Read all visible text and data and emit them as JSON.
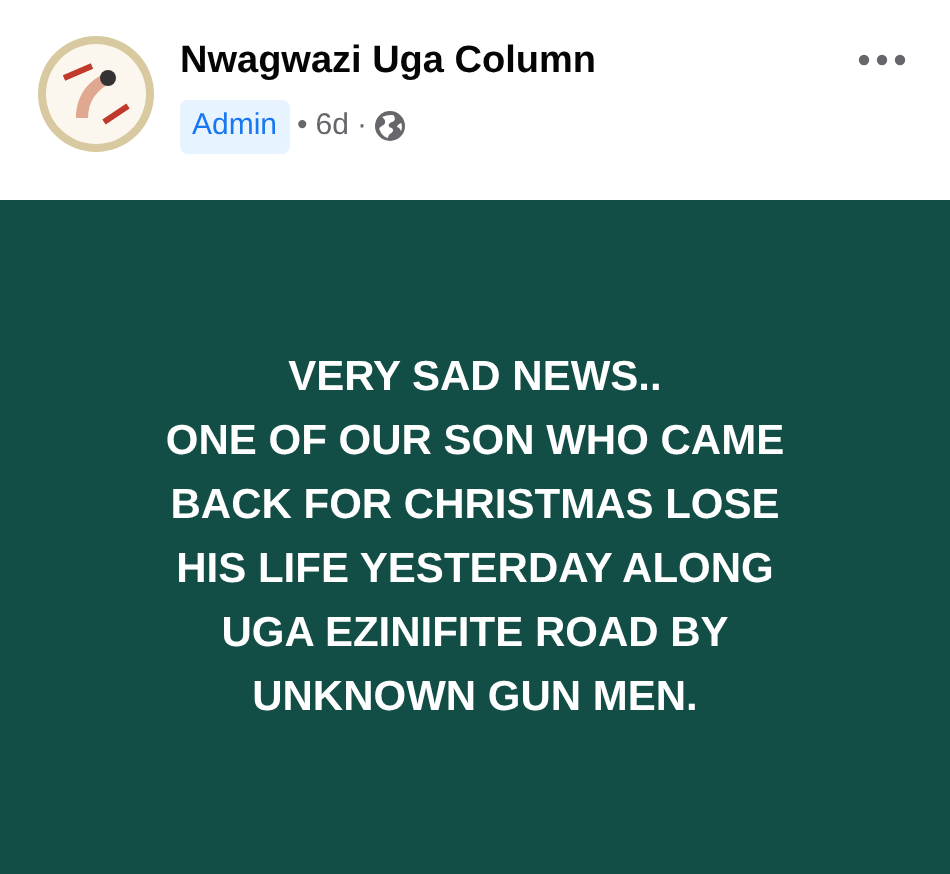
{
  "post": {
    "author": "Nwagwazi Uga Column",
    "badge": "Admin",
    "time": "6d",
    "separator_1": "•",
    "separator_2": "·",
    "public": true
  },
  "body": {
    "text": "VERY SAD NEWS..\nONE OF OUR SON WHO CAME BACK FOR CHRISTMAS LOSE HIS LIFE YESTERDAY ALONG UGA EZINIFITE ROAD BY UNKNOWN GUN MEN."
  }
}
